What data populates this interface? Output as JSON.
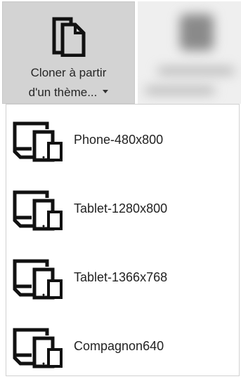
{
  "ribbon": {
    "clone_button": {
      "label_line1": "Cloner à partir",
      "label_line2": "d'un thème...",
      "icon": "copy-pages-icon"
    },
    "blurred_button": {
      "icon": "blurred-icon"
    }
  },
  "dropdown": {
    "items": [
      {
        "label": "Phone-480x800",
        "icon": "devices-icon"
      },
      {
        "label": "Tablet-1280x800",
        "icon": "devices-icon"
      },
      {
        "label": "Tablet-1366x768",
        "icon": "devices-icon"
      },
      {
        "label": "Compagnon640",
        "icon": "devices-icon"
      }
    ]
  },
  "colors": {
    "button_bg": "#d3d3d3",
    "text": "#222222",
    "icon": "#111111"
  }
}
